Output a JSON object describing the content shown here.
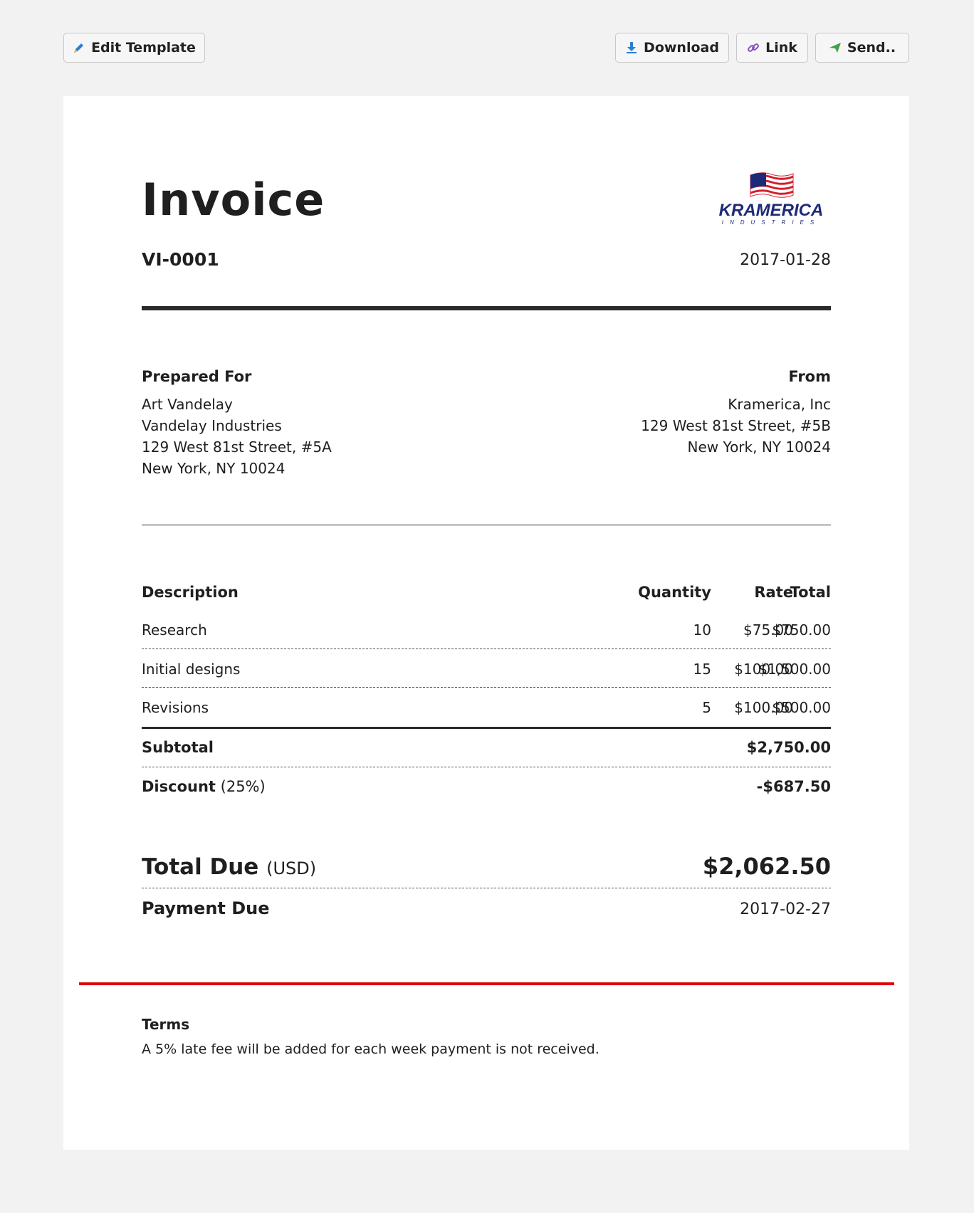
{
  "toolbar": {
    "edit_label": "Edit Template",
    "download_label": "Download",
    "link_label": "Link",
    "send_label": "Send.."
  },
  "invoice": {
    "title": "Invoice",
    "number": "VI-0001",
    "date": "2017-01-28",
    "logo": {
      "brand": "KRAMERICA",
      "sub": "INDUSTRIES"
    }
  },
  "prepared_for": {
    "heading": "Prepared For",
    "lines": [
      "Art Vandelay",
      "Vandelay Industries",
      "129 West 81st Street, #5A",
      "New York, NY 10024"
    ]
  },
  "from": {
    "heading": "From",
    "lines": [
      "Kramerica, Inc",
      "129 West 81st Street, #5B",
      "New York, NY 10024"
    ]
  },
  "items": {
    "headers": {
      "description": "Description",
      "quantity": "Quantity",
      "rate": "Rate",
      "total": "Total"
    },
    "rows": [
      {
        "description": "Research",
        "quantity": "10",
        "rate": "$75.00",
        "total": "$750.00"
      },
      {
        "description": "Initial designs",
        "quantity": "15",
        "rate": "$100.00",
        "total": "$1,500.00"
      },
      {
        "description": "Revisions",
        "quantity": "5",
        "rate": "$100.00",
        "total": "$500.00"
      }
    ]
  },
  "summary": {
    "subtotal_label": "Subtotal",
    "subtotal_value": "$2,750.00",
    "discount_label": "Discount",
    "discount_pct": "(25%)",
    "discount_value": "-$687.50",
    "total_due_label": "Total Due",
    "total_due_unit": "(USD)",
    "total_due_value": "$2,062.50",
    "payment_due_label": "Payment Due",
    "payment_due_value": "2017-02-27"
  },
  "terms": {
    "heading": "Terms",
    "text": "A 5% late fee will be added for each week payment is not received."
  },
  "colors": {
    "background": "#f2f2f2",
    "paper": "#ffffff",
    "accent_rule": "#e00000",
    "logo_blue": "#1e2a78",
    "edit_icon": "#2a7fd4",
    "download_icon": "#2a7fd4",
    "link_icon": "#8a4fbf",
    "send_icon": "#3fa14a"
  }
}
